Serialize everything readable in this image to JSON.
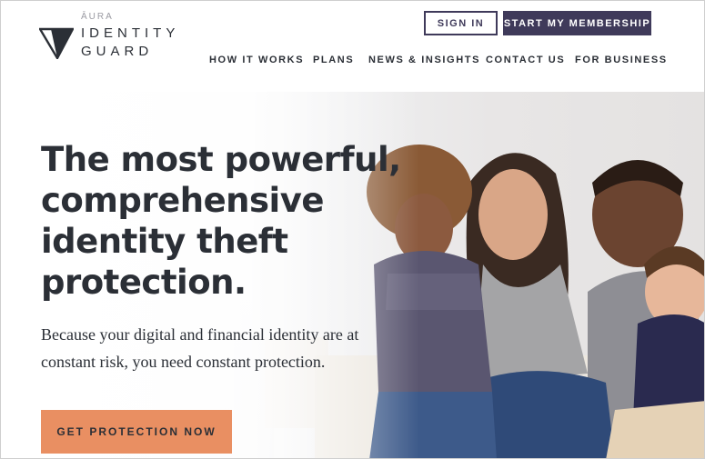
{
  "header": {
    "logo": {
      "aura": "ĀURA",
      "line1": "IDENTITY",
      "line2": "GUARD",
      "icon": "identity-guard-logo-icon"
    },
    "sign_in_label": "SIGN IN",
    "membership_label": "START MY MEMBERSHIP"
  },
  "nav": {
    "items": [
      {
        "label": "HOW IT WORKS"
      },
      {
        "label": "PLANS"
      },
      {
        "label": "NEWS & INSIGHTS"
      },
      {
        "label": "CONTACT US"
      },
      {
        "label": "FOR BUSINESS"
      }
    ]
  },
  "hero": {
    "headline_lines": [
      "The most powerful,",
      "comprehensive",
      "identity theft",
      "protection."
    ],
    "subtext_lines": [
      "Because your digital and financial identity are at",
      "constant risk, you need constant protection."
    ],
    "cta_label": "GET PROTECTION NOW"
  },
  "colors": {
    "brand_purple": "#3f3a5a",
    "cta_orange": "#e98f62",
    "text_dark": "#2b2f36"
  }
}
